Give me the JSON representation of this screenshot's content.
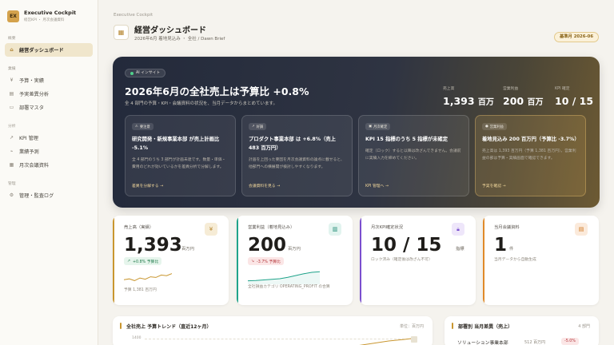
{
  "brand": {
    "logo": "EX",
    "title": "Executive Cockpit",
    "subtitle": "経営KPI ・ 月次会議資料"
  },
  "sidebar": {
    "groups": [
      {
        "label": "概要",
        "items": [
          {
            "label": "経営ダッシュボード",
            "icon": "home-icon",
            "active": true
          }
        ]
      },
      {
        "label": "業績",
        "items": [
          {
            "label": "予算・実績",
            "icon": "yen-icon"
          },
          {
            "label": "予実差異分析",
            "icon": "document-icon"
          },
          {
            "label": "部署マスタ",
            "icon": "folder-icon"
          }
        ]
      },
      {
        "label": "分析",
        "items": [
          {
            "label": "KPI 管理",
            "icon": "chart-icon"
          },
          {
            "label": "業績予測",
            "icon": "trend-icon"
          },
          {
            "label": "月次会議資料",
            "icon": "report-icon"
          }
        ]
      },
      {
        "label": "管理",
        "items": [
          {
            "label": "管理・監査ログ",
            "icon": "settings-icon"
          }
        ]
      }
    ]
  },
  "header": {
    "breadcrumb": "Executive Cockpit",
    "title": "経営ダッシュボード",
    "subtitle": "2026年6月 着地見込み ・ 全社 / Dawn Brief",
    "period_badge": "基準月 2026-06"
  },
  "hero": {
    "badge": "AI インサイト",
    "headline": "2026年6月の全社売上は予算比 +0.8%",
    "sub": "全 4 部門の予算・KPI・会議資料の状況を、当月データからまとめています。",
    "kpis": [
      {
        "label": "売上高",
        "value": "1,393",
        "unit": "百万"
      },
      {
        "label": "営業利益",
        "value": "200",
        "unit": "百万"
      },
      {
        "label": "KPI 確定",
        "value": "10 / 15",
        "unit": ""
      }
    ],
    "insights": [
      {
        "tag": "要注意",
        "title": "研究開発・新規事業本部 が売上計画比 -5.1%",
        "body": "全 4 部門のうち 3 部門が計画未達です。数量・単価・費用のどれが効いているかを差異分析で分解します。",
        "link": "差異を分解する →",
        "highlight": false
      },
      {
        "tag": "好調",
        "title": "プロダクト事業本部 は +6.8%（売上 483 百万円）",
        "body": "計画を上回った要因を月次会議資料の論点に載せると、他部門への横展開が検討しやすくなります。",
        "link": "会議資料を見る →",
        "highlight": false
      },
      {
        "tag": "月次確定",
        "title": "KPI 15 指標のうち 5 指標が未確定",
        "body": "確定（ロック）すると以降は改ざんできません。会議前に実績入力を締めてください。",
        "link": "KPI 管理へ →",
        "highlight": false
      },
      {
        "tag": "営業利益",
        "title": "着地見込み 200 百万円（予算比 -3.7%）",
        "body": "売上高は 1,393 百万円（予算 1,381 百万円）。営業利益の部は予算・実績画面で確認できます。",
        "link": "予実を確認 →",
        "highlight": true
      }
    ]
  },
  "kpi_cards": [
    {
      "label": "売上高（実績）",
      "value": "1,393",
      "unit": "百万円",
      "pill": "+0.8% 予算比",
      "note": "予算 1,381 百万円",
      "icon": "yen-icon",
      "accent": "#c9962f",
      "icon_bg": "#f6ecd6",
      "pill_bg": "#e6f5ec",
      "pill_color": "#1f7a4a",
      "spark": [
        0.35,
        0.4,
        0.3,
        0.45,
        0.38,
        0.52,
        0.48,
        0.62,
        0.58,
        0.7
      ]
    },
    {
      "label": "営業利益（着地見込み）",
      "value": "200",
      "unit": "百万円",
      "pill": "-3.7% 予算比",
      "note": "全社損益カテゴリ OPERATING_PROFIT の合算",
      "icon": "bar-chart-icon",
      "accent": "#1fa38a",
      "icon_bg": "#e2f4ef",
      "pill_bg": "#fbe6e6",
      "pill_color": "#b3353a",
      "spark": [
        0.2,
        0.22,
        0.25,
        0.28,
        0.32,
        0.4,
        0.5,
        0.6,
        0.68,
        0.72
      ]
    },
    {
      "label": "月次KPI確定状況",
      "value": "10 / 15",
      "unit": "指標",
      "pill": "",
      "note": "ロック済み（確定後は改ざん不可）",
      "icon": "lock-icon",
      "accent": "#7a4fcf",
      "icon_bg": "#eee6fa",
      "pill_bg": "",
      "pill_color": "",
      "spark": []
    },
    {
      "label": "当月会議資料",
      "value": "1",
      "unit": "件",
      "pill": "",
      "note": "当月データから自動生成",
      "icon": "file-icon",
      "accent": "#e08a2a",
      "icon_bg": "#fbeadb",
      "pill_bg": "",
      "pill_color": "",
      "spark": []
    }
  ],
  "panels": {
    "trend": {
      "title": "全社売上 予算トレンド（直近12ヶ月）",
      "right": "単位：百万円",
      "axis_label": "1400"
    },
    "dept": {
      "title": "部署別 当月差異（売上）",
      "right": "4 部門",
      "row_label": "ソリューション事業本部",
      "row_value": "512 百万円",
      "row_pill": "-5.0%"
    }
  }
}
